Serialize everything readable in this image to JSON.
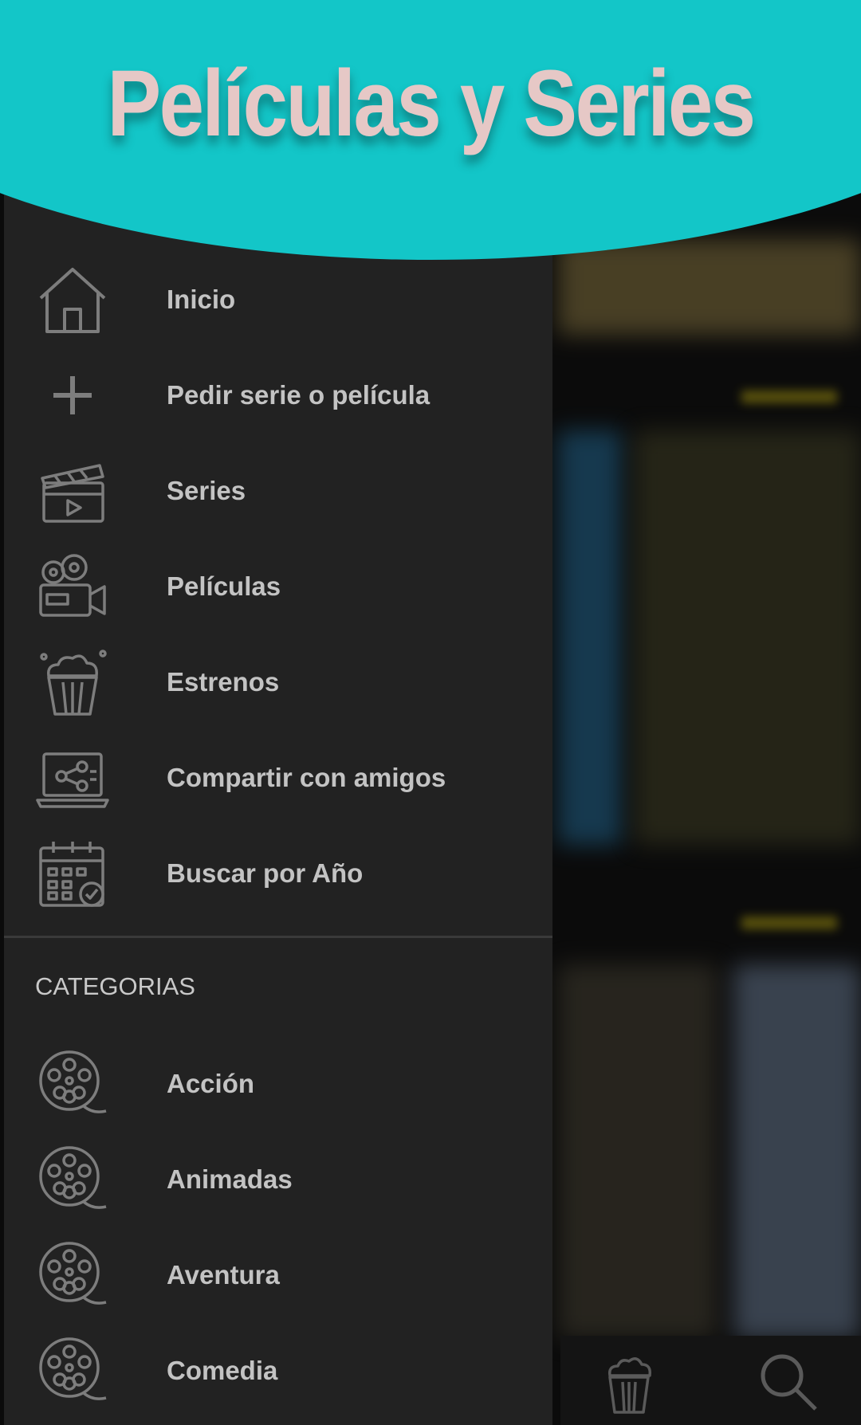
{
  "header": {
    "title": "Películas y Series"
  },
  "drawer": {
    "items": [
      {
        "label": "Inicio",
        "icon": "home-icon"
      },
      {
        "label": "Pedir serie o película",
        "icon": "plus-icon"
      },
      {
        "label": "Series",
        "icon": "clapperboard-icon"
      },
      {
        "label": "Películas",
        "icon": "movie-camera-icon"
      },
      {
        "label": "Estrenos",
        "icon": "popcorn-icon"
      },
      {
        "label": "Compartir con amigos",
        "icon": "share-laptop-icon"
      },
      {
        "label": "Buscar por Año",
        "icon": "calendar-icon"
      }
    ],
    "section_title": "CATEGORIAS",
    "categories": [
      {
        "label": "Acción",
        "icon": "film-reel-icon"
      },
      {
        "label": "Animadas",
        "icon": "film-reel-icon"
      },
      {
        "label": "Aventura",
        "icon": "film-reel-icon"
      },
      {
        "label": "Comedia",
        "icon": "film-reel-icon"
      }
    ]
  },
  "bottom_nav": {
    "icons": [
      "popcorn-icon",
      "search-icon"
    ]
  },
  "colors": {
    "accent": "#13c6c8",
    "title": "#e6c8c6",
    "drawer": "#222222",
    "text": "#c3c3c3"
  }
}
